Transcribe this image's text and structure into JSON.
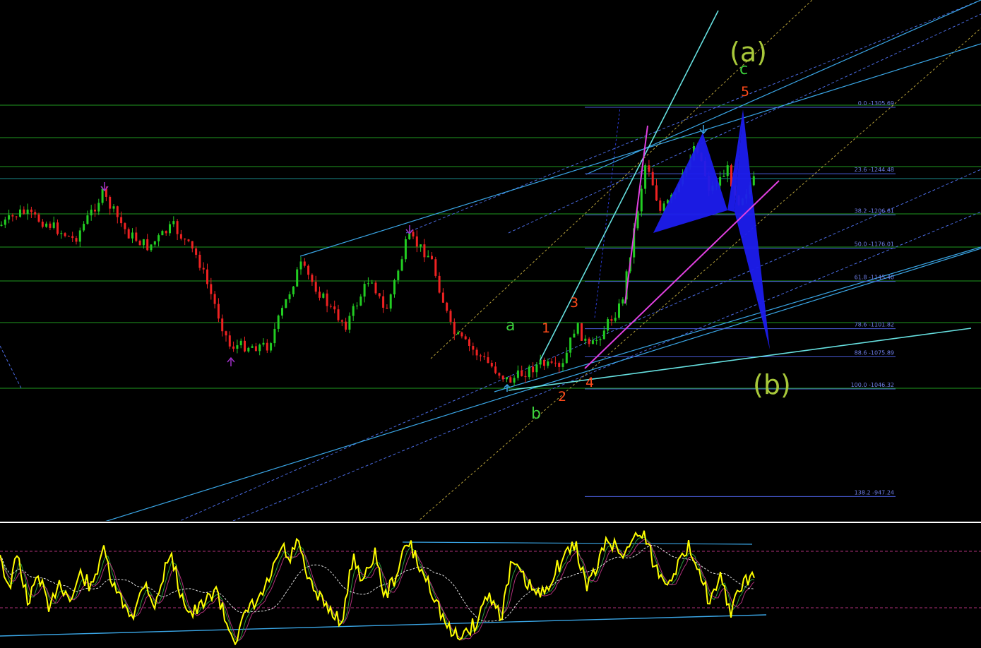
{
  "wave_labels": {
    "a": "a",
    "b": "b",
    "c": "c",
    "n1": "1",
    "n2": "2",
    "n3": "3",
    "n4": "4",
    "n5": "5",
    "big_a": "(a)",
    "big_b": "(b)"
  },
  "fibonacci_levels": [
    {
      "label": "0.0 -1305.69",
      "price": 1305.69
    },
    {
      "label": "23.6 -1244.48",
      "price": 1244.48
    },
    {
      "label": "38.2 -1206.61",
      "price": 1206.61
    },
    {
      "label": "50.0 -1176.01",
      "price": 1176.01
    },
    {
      "label": "61.8 -1145.40",
      "price": 1145.4
    },
    {
      "label": "78.6 -1101.82",
      "price": 1101.82
    },
    {
      "label": "88.6 -1075.89",
      "price": 1075.89
    },
    {
      "label": "100.0 -1046.32",
      "price": 1046.32
    },
    {
      "label": "138.2 -947.24",
      "price": 947.24
    }
  ],
  "colors": {
    "background": "#000000",
    "candle_up": "#22cc22",
    "candle_down": "#ee2222",
    "fib_line": "#4a5bd8",
    "fib_text": "#6f7fe8",
    "horizontal_level": "#1f9a1f",
    "channel_line": "#3aa6e6",
    "trend_cyan": "#66e0e0",
    "wedge_magenta": "#e040e0",
    "harmonic_pattern": "#1c1cee",
    "wave_green": "#3cd13c",
    "wave_orange": "#ff4a1a",
    "wave_olive": "#a8c83a",
    "oscillator_main": "#ffff00",
    "oscillator_level": "#b0307a",
    "arrow_purple": "#a030c8"
  },
  "icons": {
    "fractal_up": "fractal-up-arrow",
    "fractal_down": "fractal-down-arrow"
  }
}
